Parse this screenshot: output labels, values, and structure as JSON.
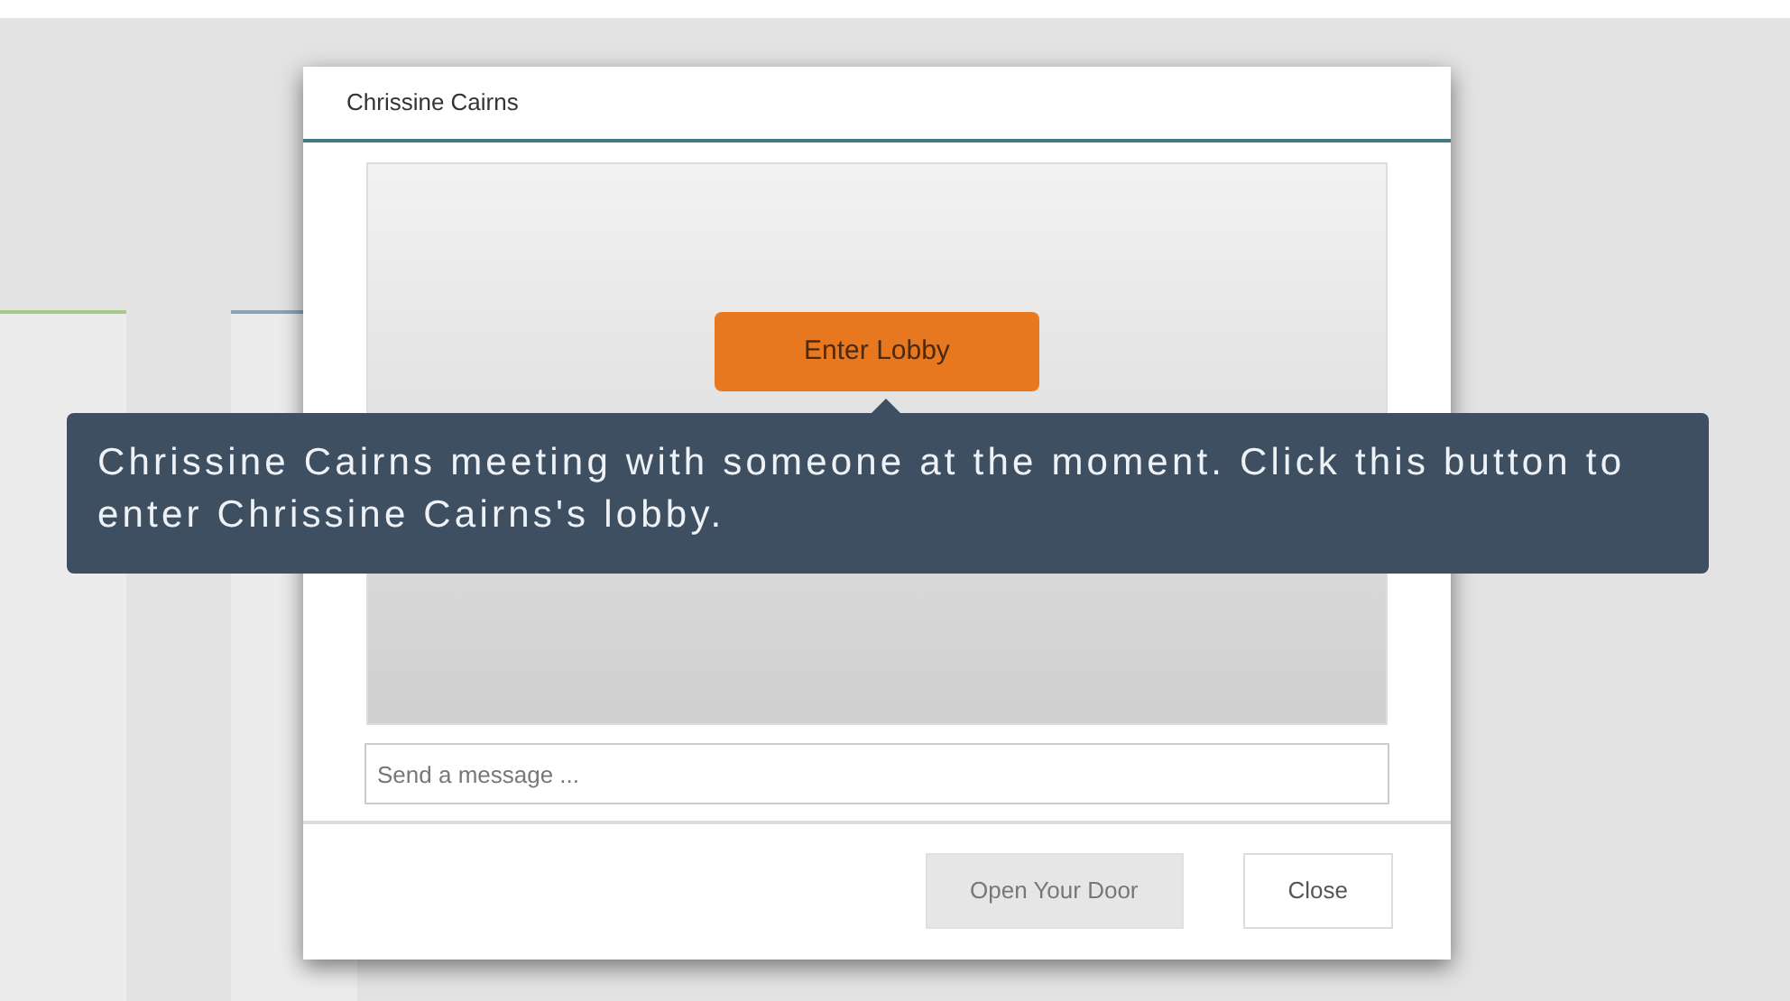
{
  "dialog": {
    "title": "Chrissine Cairns",
    "enter_button": {
      "label": "Enter Lobby"
    },
    "tooltip": {
      "text": "Chrissine Cairns meeting with someone at the moment. Click this button to enter Chrissine Cairns's lobby."
    },
    "message": {
      "placeholder": "Send a message ..."
    },
    "buttons": [
      {
        "label": "Open Your Door",
        "disabled": true
      },
      {
        "label": "Close",
        "disabled": false
      }
    ]
  }
}
